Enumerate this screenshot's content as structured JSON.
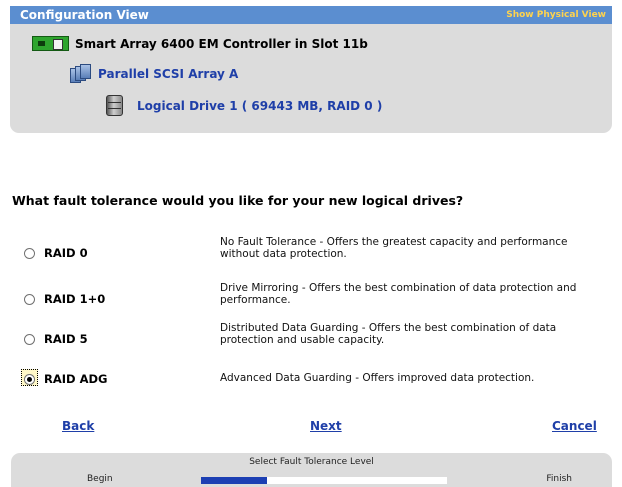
{
  "config_view": {
    "title": "Configuration View",
    "show_physical_link": "Show Physical View",
    "controller_label": "Smart Array 6400 EM Controller in Slot 11b",
    "array_label": "Parallel SCSI Array A",
    "logical_drive_label": "Logical Drive 1 ( 69443 MB, RAID 0 )"
  },
  "question": "What fault tolerance would you like for your new logical drives?",
  "options": [
    {
      "label": "RAID 0",
      "description": "No Fault Tolerance - Offers the greatest capacity and performance without data protection.",
      "selected": false
    },
    {
      "label": "RAID 1+0",
      "description": "Drive Mirroring - Offers the best combination of data protection and performance.",
      "selected": false
    },
    {
      "label": "RAID 5",
      "description": "Distributed Data Guarding - Offers the best combination of data protection and usable capacity.",
      "selected": false
    },
    {
      "label": "RAID ADG",
      "description": "Advanced Data Guarding - Offers improved data protection.",
      "selected": true
    }
  ],
  "nav": {
    "back": "Back",
    "next": "Next",
    "cancel": "Cancel"
  },
  "progress": {
    "title": "Select Fault Tolerance Level",
    "begin": "Begin",
    "finish": "Finish",
    "fraction": 0.27
  },
  "colors": {
    "header_blue": "#5b8ed0",
    "link_blue": "#1f3fa8",
    "progress_fill": "#1c3fb3",
    "panel_gray": "#dcdcdc"
  },
  "icons": {
    "controller": "controller-card-icon",
    "array": "disk-array-icon",
    "logical_drive": "logical-drive-icon"
  }
}
